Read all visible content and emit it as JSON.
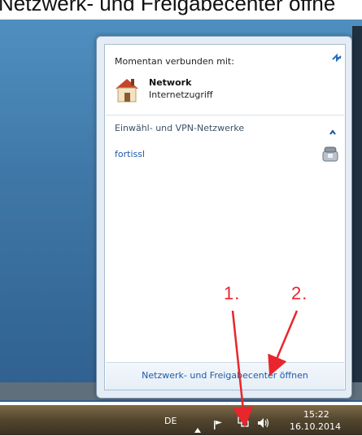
{
  "caption": "Netzwerk- und Freigabecenter öffne",
  "popup": {
    "connected_label": "Momentan verbunden mit:",
    "network_name": "Network",
    "network_status": "Internetzugriff",
    "vpn_section_label": "Einwähl- und VPN-Netzwerke",
    "vpn_item": "fortissl",
    "footer_link": "Netzwerk- und Freigabecenter öffnen"
  },
  "annotations": {
    "label1": "1.",
    "label2": "2."
  },
  "taskbar": {
    "language": "DE",
    "time": "15:22",
    "date": "16.10.2014"
  },
  "colors": {
    "accent": "#1e5aa8",
    "annotation": "#e8262c"
  }
}
